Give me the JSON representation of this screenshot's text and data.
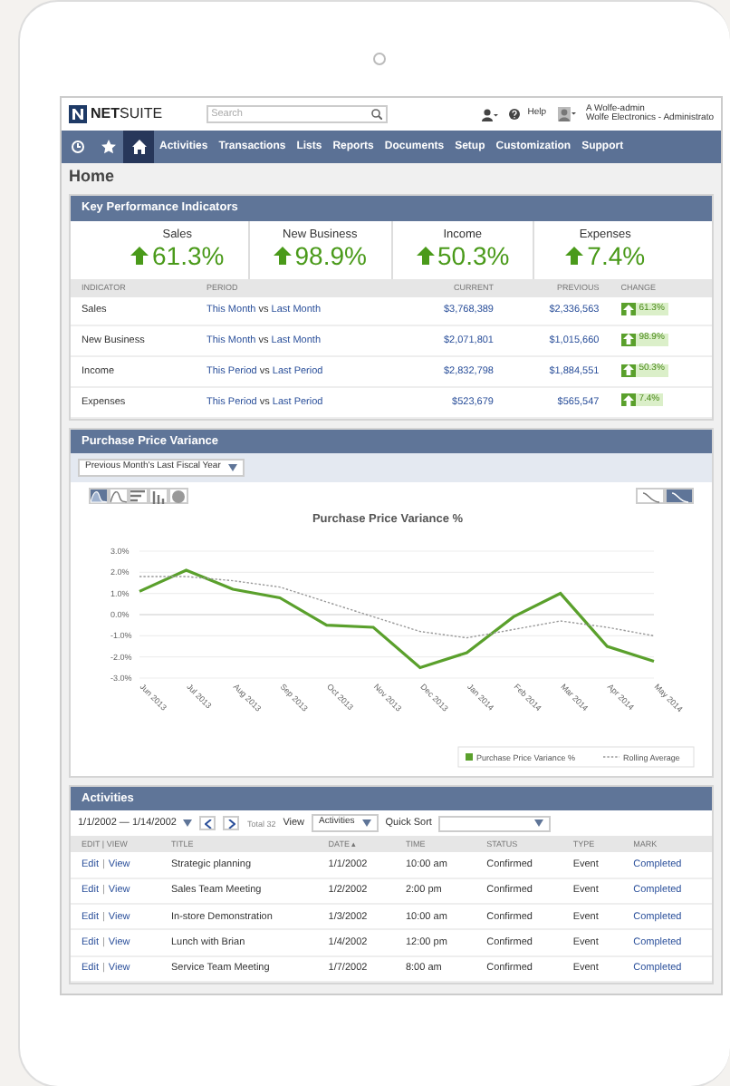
{
  "header": {
    "logo": "**NET**SUITE",
    "search": {
      "placeholder": "Search"
    },
    "help": "Help",
    "user_name": "A Wolfe-admin",
    "user_role": "Wolfe Electronics - Administrato"
  },
  "nav": {
    "icons": [
      {
        "kind": "recent",
        "selected": false
      },
      {
        "kind": "star",
        "selected": false
      },
      {
        "kind": "home",
        "selected": true
      }
    ],
    "items": [
      "Activities",
      "Transactions",
      "Lists",
      "Reports",
      "Documents",
      "Setup",
      "Customization",
      "Support"
    ]
  },
  "page_title": "Home",
  "kpi": {
    "title": "Key Performance Indicators",
    "summary": [
      {
        "label": "Sales",
        "value": "61.3%"
      },
      {
        "label": "New Business",
        "value": "98.9%"
      },
      {
        "label": "Income",
        "value": "50.3%"
      },
      {
        "label": "Expenses",
        "value": "7.4%"
      }
    ],
    "columns": [
      "INDICATOR",
      "PERIOD",
      "CURRENT",
      "PREVIOUS",
      "CHANGE"
    ],
    "rows": [
      {
        "indicator": "Sales",
        "period_from": "This Month",
        "joiner": "vs",
        "period_to": "Last Month",
        "current": "$3,768,389",
        "previous": "$2,336,563",
        "change": "61.3%"
      },
      {
        "indicator": "New Business",
        "period_from": "This Month",
        "joiner": "vs",
        "period_to": "Last Month",
        "current": "$2,071,801",
        "previous": "$1,015,660",
        "change": "98.9%"
      },
      {
        "indicator": "Income",
        "period_from": "This Period",
        "joiner": "vs",
        "period_to": "Last Period",
        "current": "$2,832,798",
        "previous": "$1,884,551",
        "change": "50.3%"
      },
      {
        "indicator": "Expenses",
        "period_from": "This Period",
        "joiner": "vs",
        "period_to": "Last Period",
        "current": "$523,679",
        "previous": "$565,547",
        "change": "7.4%"
      }
    ]
  },
  "ppv": {
    "title": "Purchase Price Variance",
    "filter": "Previous Month's Last Fiscal Year",
    "chart_types": [
      {
        "kind": "area",
        "selected": true
      },
      {
        "kind": "line",
        "selected": false
      },
      {
        "kind": "bar",
        "selected": false
      },
      {
        "kind": "column",
        "selected": false
      },
      {
        "kind": "pie",
        "selected": false
      }
    ],
    "style_toggle": [
      {
        "kind": "plain",
        "selected": false
      },
      {
        "kind": "smooth",
        "selected": true
      }
    ],
    "chart_data": {
      "type": "line",
      "title": "Purchase Price Variance %",
      "categories": [
        "Jun 2013",
        "Jul 2013",
        "Aug 2013",
        "Sep 2013",
        "Oct 2013",
        "Nov 2013",
        "Dec 2013",
        "Jan 2014",
        "Feb 2014",
        "Mar 2014",
        "Apr 2014",
        "May 2014"
      ],
      "series": [
        {
          "name": "Purchase Price Variance %",
          "color": "#5aa02c",
          "line_style": "solid",
          "values": [
            1.1,
            2.1,
            1.2,
            0.8,
            -0.5,
            -0.6,
            -2.5,
            -1.8,
            -0.1,
            1.0,
            -1.5,
            -2.2
          ]
        },
        {
          "name": "Rolling Average",
          "color": "#999999",
          "line_style": "dashed",
          "values": [
            1.8,
            1.8,
            1.6,
            1.3,
            0.6,
            -0.1,
            -0.8,
            -1.1,
            -0.7,
            -0.3,
            -0.6,
            -1.0
          ]
        }
      ],
      "grid": true,
      "legend": "bottom-right",
      "ylim": [
        -3,
        3
      ],
      "yticks": [
        {
          "value": 3,
          "label": "3.0%"
        },
        {
          "value": 2,
          "label": "2.0%"
        },
        {
          "value": 1,
          "label": "1.0%"
        },
        {
          "value": 0,
          "label": "0.0%"
        },
        {
          "value": -1,
          "label": "-1.0%"
        },
        {
          "value": -2,
          "label": "-2.0%"
        },
        {
          "value": -3,
          "label": "-3.0%"
        }
      ]
    }
  },
  "activities": {
    "title": "Activities",
    "date_range": "1/1/2002 — 1/14/2002",
    "total": "Total 32",
    "view_label": "View",
    "view_value": "Activities",
    "quick_sort_label": "Quick Sort",
    "columns": [
      "EDIT | VIEW",
      "TITLE",
      "DATE ▴",
      "TIME",
      "STATUS",
      "TYPE",
      "MARK"
    ],
    "rows": [
      {
        "edit": "Edit",
        "separator": "|",
        "view": "View",
        "title": "Strategic planning",
        "date": "1/1/2002",
        "time": "10:00 am",
        "status": "Confirmed",
        "type": "Event",
        "mark": "Completed"
      },
      {
        "edit": "Edit",
        "separator": "|",
        "view": "View",
        "title": "Sales Team Meeting",
        "date": "1/2/2002",
        "time": "2:00 pm",
        "status": "Confirmed",
        "type": "Event",
        "mark": "Completed"
      },
      {
        "edit": "Edit",
        "separator": "|",
        "view": "View",
        "title": "In-store Demonstration",
        "date": "1/3/2002",
        "time": "10:00 am",
        "status": "Confirmed",
        "type": "Event",
        "mark": "Completed"
      },
      {
        "edit": "Edit",
        "separator": "|",
        "view": "View",
        "title": "Lunch with Brian",
        "date": "1/4/2002",
        "time": "12:00 pm",
        "status": "Confirmed",
        "type": "Event",
        "mark": "Completed"
      },
      {
        "edit": "Edit",
        "separator": "|",
        "view": "View",
        "title": "Service Team Meeting",
        "date": "1/7/2002",
        "time": "8:00 am",
        "status": "Confirmed",
        "type": "Event",
        "mark": "Completed"
      }
    ]
  }
}
